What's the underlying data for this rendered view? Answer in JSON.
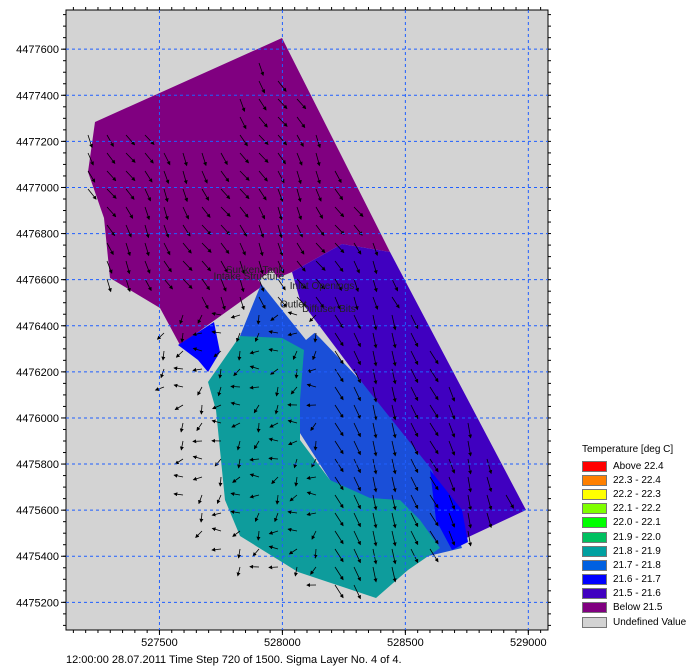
{
  "chart_data": {
    "type": "map",
    "x_ticks": [
      527500,
      528000,
      528500,
      529000
    ],
    "y_ticks": [
      4475200,
      4475400,
      4475600,
      4475800,
      4476000,
      4476200,
      4476400,
      4476600,
      4476800,
      4477000,
      4477200,
      4477400,
      4477600
    ],
    "xlim": [
      527120,
      529080
    ],
    "ylim": [
      4475080,
      4477770
    ],
    "grid": true,
    "legend_position": "bottom-right",
    "legend": {
      "title": "Temperature [deg C]",
      "items": [
        {
          "label": "Above 22.4",
          "color": "#ff0000"
        },
        {
          "label": "22.3 - 22.4",
          "color": "#ff8000"
        },
        {
          "label": "22.2 - 22.3",
          "color": "#ffff00"
        },
        {
          "label": "22.1 - 22.2",
          "color": "#80ff00"
        },
        {
          "label": "22.0 - 22.1",
          "color": "#00ff00"
        },
        {
          "label": "21.9 - 22.0",
          "color": "#00c060"
        },
        {
          "label": "21.8 - 21.9",
          "color": "#00a0a0"
        },
        {
          "label": "21.7 - 21.8",
          "color": "#0060e0"
        },
        {
          "label": "21.6 - 21.7",
          "color": "#0000ff"
        },
        {
          "label": "21.5 - 21.6",
          "color": "#4000c0"
        },
        {
          "label": "Below 21.5",
          "color": "#800080"
        },
        {
          "label": "Undefined Value",
          "color": "#d3d3d3"
        }
      ]
    },
    "domain_outline": [
      [
        527730,
        4477180
      ],
      [
        527930,
        4477640
      ],
      [
        528950,
        4475620
      ],
      [
        528290,
        4475230
      ],
      [
        527760,
        4475360
      ],
      [
        527590,
        4475620
      ],
      [
        527540,
        4476050
      ],
      [
        527450,
        4476330
      ],
      [
        527660,
        4476610
      ],
      [
        527520,
        4476550
      ],
      [
        527280,
        4476600
      ],
      [
        527180,
        4477060
      ],
      [
        527210,
        4477270
      ]
    ],
    "annotations": [
      {
        "text": "Sunken Tank",
        "x": 527770,
        "y": 4476630
      },
      {
        "text": "Intake Structure",
        "x": 527720,
        "y": 4476600
      },
      {
        "text": "Inlet Openings",
        "x": 528030,
        "y": 4476560
      },
      {
        "text": "Outlet",
        "x": 527990,
        "y": 4476480
      },
      {
        "text": "Diffuser Bits",
        "x": 528080,
        "y": 4476460
      }
    ]
  },
  "status": "12:00:00 28.07.2011  Time Step 720 of 1500. Sigma Layer No. 4 of 4."
}
